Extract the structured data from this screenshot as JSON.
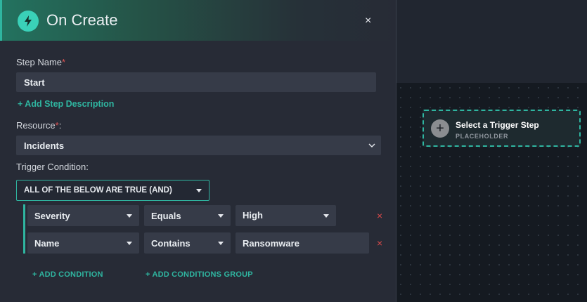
{
  "panel": {
    "title": "On Create",
    "close": "×",
    "icon": "lightning-bolt-icon"
  },
  "step_name": {
    "label": "Step Name",
    "required_mark": "*",
    "value": "Start"
  },
  "add_description_link": "+ Add Step Description",
  "resource": {
    "label": "Resource",
    "required_mark": "*",
    "suffix": ":",
    "value": "Incidents"
  },
  "trigger_condition": {
    "label": "Trigger Condition:",
    "operator": "ALL OF THE BELOW ARE TRUE (AND)",
    "conditions": [
      {
        "field": "Severity",
        "comparator": "Equals",
        "value": "High",
        "delete": "×"
      },
      {
        "field": "Name",
        "comparator": "Contains",
        "value": "Ransomware",
        "delete": "×"
      }
    ],
    "add_condition": "+ ADD CONDITION",
    "add_group": "+ ADD CONDITIONS GROUP"
  },
  "trigger_placeholder": {
    "title": "Select a Trigger Step",
    "subtitle": "PLACEHOLDER",
    "icon": "plus-icon"
  },
  "colors": {
    "accent": "#2fb5a0",
    "panel_bg": "#272b36",
    "input_bg": "#363b48",
    "danger": "#d94a4a"
  }
}
